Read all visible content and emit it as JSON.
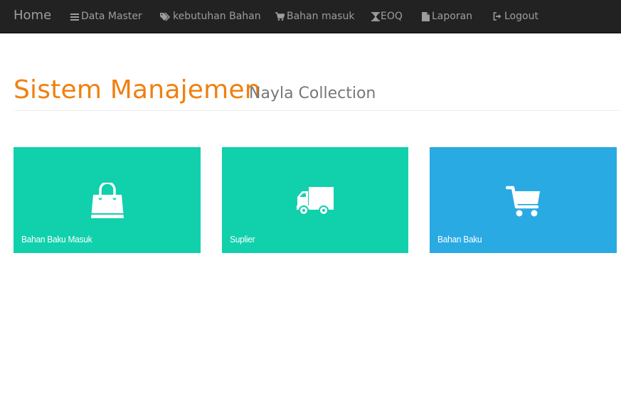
{
  "nav": {
    "brand": "Home",
    "items": [
      {
        "label": "Data Master",
        "icon": "menu-icon"
      },
      {
        "label": "kebutuhan Bahan",
        "icon": "tags-icon"
      },
      {
        "label": "Bahan masuk",
        "icon": "shopping-cart-icon"
      },
      {
        "label": "EOQ",
        "icon": "hourglass-icon"
      },
      {
        "label": "Laporan",
        "icon": "file-icon"
      },
      {
        "label": "Logout",
        "icon": "sign-out-icon"
      }
    ]
  },
  "header": {
    "title": "Sistem Manajemen",
    "subtitle": "Nayla Collection"
  },
  "tiles": [
    {
      "label": "Bahan Baku Masuk",
      "icon": "shopping-bag-icon",
      "color": "#11d0ac"
    },
    {
      "label": "Suplier",
      "icon": "truck-icon",
      "color": "#11d0ac"
    },
    {
      "label": "Bahan Baku",
      "icon": "cart-icon",
      "color": "#29aae3"
    }
  ],
  "colors": {
    "navbar": "#222222",
    "nav_text": "#9d9d9d",
    "title": "#f0800f",
    "subtitle": "#777777"
  }
}
